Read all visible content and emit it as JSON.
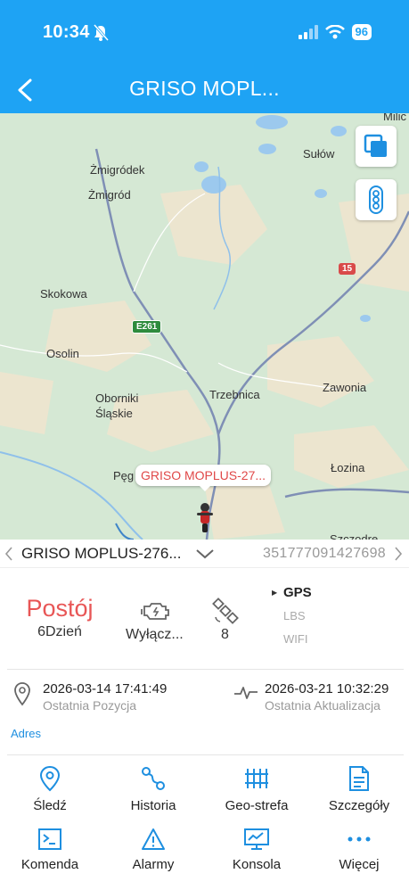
{
  "status_bar": {
    "time": "10:34",
    "battery": "96"
  },
  "header": {
    "title": "GRISO MOPL..."
  },
  "map": {
    "places": [
      "Milic",
      "Sułów",
      "Żmigródek",
      "Żmigród",
      "Skokowa",
      "Osolin",
      "Oborniki",
      "Śląskie",
      "Trzebnica",
      "Zawonia",
      "Pęg",
      "Łozina",
      "Szczodre"
    ],
    "road_badges": [
      "E261",
      "15"
    ],
    "device_callout": "GRISO MOPLUS-27..."
  },
  "device": {
    "name": "GRISO MOPLUS-276...",
    "imei": "351777091427698"
  },
  "status": {
    "state": "Postój",
    "duration": "6Dzień",
    "engine": "Wyłącz...",
    "satellites": "8",
    "modes": [
      "GPS",
      "LBS",
      "WIFI"
    ]
  },
  "position": {
    "time": "2026-03-14 17:41:49",
    "label": "Ostatnia Pozycja"
  },
  "update": {
    "time": "2026-03-21 10:32:29",
    "label": "Ostatnia Aktualizacja"
  },
  "address_label": "Adres",
  "actions": [
    {
      "label": "Śledź",
      "icon": "location-pin-icon"
    },
    {
      "label": "Historia",
      "icon": "route-icon"
    },
    {
      "label": "Geo-strefa",
      "icon": "geofence-icon"
    },
    {
      "label": "Szczegóły",
      "icon": "document-icon"
    },
    {
      "label": "Komenda",
      "icon": "terminal-icon"
    },
    {
      "label": "Alarmy",
      "icon": "warning-icon"
    },
    {
      "label": "Konsola",
      "icon": "monitor-icon"
    },
    {
      "label": "Więcej",
      "icon": "more-icon"
    }
  ],
  "colors": {
    "accent": "#1ea3f4",
    "stop_state": "#e85656",
    "link": "#1e8fe0"
  }
}
